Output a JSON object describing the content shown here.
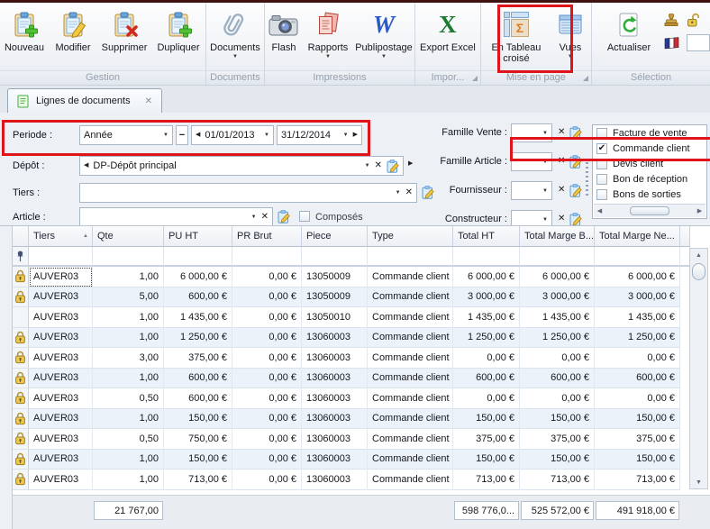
{
  "icons": {
    "dropdown": "▼",
    "clear": "✕",
    "left_arrow": "◀",
    "right_arrow": "▶",
    "minus": "−",
    "sort_asc": "▲",
    "check": "✔",
    "up": "▲",
    "down": "▼",
    "word": "W",
    "excel": "X",
    "sigma": "Σ",
    "close": "✕"
  },
  "toolbar": {
    "groups": [
      {
        "label": "Gestion",
        "buttons": [
          {
            "label": "Nouveau"
          },
          {
            "label": "Modifier"
          },
          {
            "label": "Supprimer"
          },
          {
            "label": "Dupliquer"
          }
        ]
      },
      {
        "label": "Documents",
        "buttons": [
          {
            "label": "Documents"
          }
        ]
      },
      {
        "label": "Impressions",
        "buttons": [
          {
            "label": "Flash"
          },
          {
            "label": "Rapports"
          },
          {
            "label": "Publipostage"
          }
        ]
      },
      {
        "label": "Impor...",
        "buttons": [
          {
            "label": "Export Excel"
          }
        ]
      },
      {
        "label": "Mise en page",
        "buttons": [
          {
            "label": "En Tableau croisé"
          },
          {
            "label": "Vues"
          }
        ]
      },
      {
        "label": "Sélection",
        "buttons": [
          {
            "label": "Actualiser"
          }
        ]
      }
    ]
  },
  "tab": {
    "label": "Lignes de documents"
  },
  "filters": {
    "periode_label": "Periode :",
    "periode_value": "Année",
    "date_from": "01/01/2013",
    "date_to": "31/12/2014",
    "depot_label": "Dépôt :",
    "depot_value": "DP-Dépôt principal",
    "tiers_label": "Tiers :",
    "tiers_value": "",
    "article_label": "Article :",
    "article_value": "",
    "composes_label": "Composés",
    "famille_vente_label": "Famille Vente :",
    "famille_article_label": "Famille Article :",
    "fournisseur_label": "Fournisseur :",
    "constructeur_label": "Constructeur :"
  },
  "doc_types": {
    "items": [
      {
        "label": "Facture de vente",
        "checked": false
      },
      {
        "label": "Commande client",
        "checked": true
      },
      {
        "label": "Devis client",
        "checked": false
      },
      {
        "label": "Bon de réception",
        "checked": false
      },
      {
        "label": "Bons de sorties",
        "checked": false
      }
    ]
  },
  "grid": {
    "columns": {
      "tiers": "Tiers",
      "qte": "Qte",
      "pu": "PU HT",
      "pr": "PR Brut",
      "piece": "Piece",
      "type": "Type",
      "ht": "Total HT",
      "mb": "Total Marge B...",
      "mn": "Total Marge Ne..."
    },
    "rows": [
      {
        "lock": true,
        "tiers": "AUVER03",
        "qte": "1,00",
        "pu": "6 000,00 €",
        "pr": "0,00 €",
        "piece": "13050009",
        "type": "Commande client",
        "ht": "6 000,00 €",
        "mb": "6 000,00 €",
        "mn": "6 000,00 €"
      },
      {
        "lock": true,
        "tiers": "AUVER03",
        "qte": "5,00",
        "pu": "600,00 €",
        "pr": "0,00 €",
        "piece": "13050009",
        "type": "Commande client",
        "ht": "3 000,00 €",
        "mb": "3 000,00 €",
        "mn": "3 000,00 €"
      },
      {
        "lock": false,
        "tiers": "AUVER03",
        "qte": "1,00",
        "pu": "1 435,00 €",
        "pr": "0,00 €",
        "piece": "13050010",
        "type": "Commande client",
        "ht": "1 435,00 €",
        "mb": "1 435,00 €",
        "mn": "1 435,00 €"
      },
      {
        "lock": true,
        "tiers": "AUVER03",
        "qte": "1,00",
        "pu": "1 250,00 €",
        "pr": "0,00 €",
        "piece": "13060003",
        "type": "Commande client",
        "ht": "1 250,00 €",
        "mb": "1 250,00 €",
        "mn": "1 250,00 €"
      },
      {
        "lock": true,
        "tiers": "AUVER03",
        "qte": "3,00",
        "pu": "375,00 €",
        "pr": "0,00 €",
        "piece": "13060003",
        "type": "Commande client",
        "ht": "0,00 €",
        "mb": "0,00 €",
        "mn": "0,00 €"
      },
      {
        "lock": true,
        "tiers": "AUVER03",
        "qte": "1,00",
        "pu": "600,00 €",
        "pr": "0,00 €",
        "piece": "13060003",
        "type": "Commande client",
        "ht": "600,00 €",
        "mb": "600,00 €",
        "mn": "600,00 €"
      },
      {
        "lock": true,
        "tiers": "AUVER03",
        "qte": "0,50",
        "pu": "600,00 €",
        "pr": "0,00 €",
        "piece": "13060003",
        "type": "Commande client",
        "ht": "0,00 €",
        "mb": "0,00 €",
        "mn": "0,00 €"
      },
      {
        "lock": true,
        "tiers": "AUVER03",
        "qte": "1,00",
        "pu": "150,00 €",
        "pr": "0,00 €",
        "piece": "13060003",
        "type": "Commande client",
        "ht": "150,00 €",
        "mb": "150,00 €",
        "mn": "150,00 €"
      },
      {
        "lock": true,
        "tiers": "AUVER03",
        "qte": "0,50",
        "pu": "750,00 €",
        "pr": "0,00 €",
        "piece": "13060003",
        "type": "Commande client",
        "ht": "375,00 €",
        "mb": "375,00 €",
        "mn": "375,00 €"
      },
      {
        "lock": true,
        "tiers": "AUVER03",
        "qte": "1,00",
        "pu": "150,00 €",
        "pr": "0,00 €",
        "piece": "13060003",
        "type": "Commande client",
        "ht": "150,00 €",
        "mb": "150,00 €",
        "mn": "150,00 €"
      },
      {
        "lock": true,
        "tiers": "AUVER03",
        "qte": "1,00",
        "pu": "713,00 €",
        "pr": "0,00 €",
        "piece": "13060003",
        "type": "Commande client",
        "ht": "713,00 €",
        "mb": "713,00 €",
        "mn": "713,00 €"
      }
    ],
    "footer": {
      "qte": "21 767,00",
      "ht": "598 776,0...",
      "mb": "525 572,00 €",
      "mn": "491 918,00 €"
    }
  }
}
